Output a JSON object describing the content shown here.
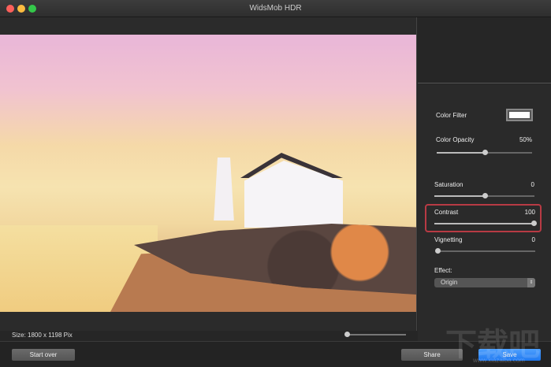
{
  "window": {
    "title": "WidsMob HDR",
    "traffic_lights": {
      "close": "#fc605b",
      "minimize": "#fdbc40",
      "zoom": "#34c84a"
    }
  },
  "canvas": {
    "size_label": "Size: 1800 x 1198 Pix",
    "zoom_level": 0
  },
  "panel": {
    "color_filter": {
      "label": "Color Filter",
      "color": "#ffffff"
    },
    "color_opacity": {
      "label": "Color Opacity",
      "value": "50%",
      "level": 0.5
    },
    "saturation": {
      "label": "Saturation",
      "value": "0",
      "level": 0.5
    },
    "contrast": {
      "label": "Contrast",
      "value": "100",
      "level": 1.0
    },
    "vignetting": {
      "label": "Vignetting",
      "value": "0",
      "level": 0.0
    },
    "effect": {
      "label": "Effect:",
      "selected": "Origin"
    }
  },
  "buttons": {
    "start_over": "Start over",
    "share": "Share",
    "save": "Save"
  },
  "watermark": {
    "text": "下载吧",
    "url": "www.xiazaiba.com"
  }
}
